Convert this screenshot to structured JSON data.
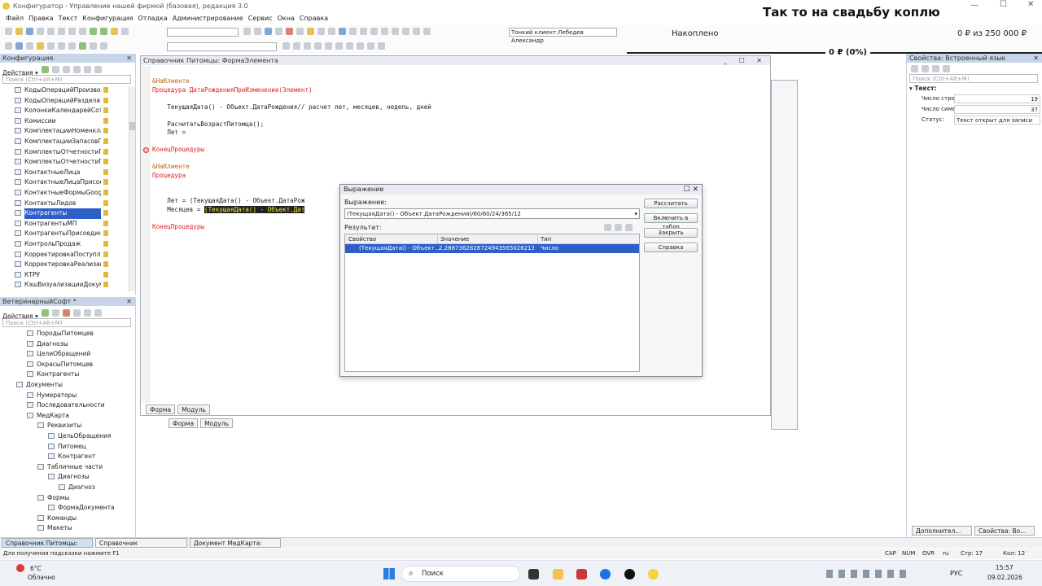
{
  "window_title": "Конфигуратор - Управление нашей фирмой (базовая), редакция 3.0",
  "menu": [
    "Файл",
    "Правка",
    "Текст",
    "Конфигурация",
    "Отладка",
    "Администрирование",
    "Сервис",
    "Окна",
    "Справка"
  ],
  "client_combo": "Тонкий клиент:Лебедев Александр",
  "overlay": {
    "title": "Так то на свадьбу коплю",
    "saved_label": "Накоплено",
    "amount": "0 ₽ из 250 000 ₽",
    "percent": "0 ₽ (0%)",
    "progress": 0
  },
  "config_panel": {
    "title": "Конфигурация",
    "actions": "Действия",
    "search": "Поиск (Ctrl+Alt+M)",
    "items": [
      "КодыОперацийПроизвол...",
      "КодыОперацийРаздела7...",
      "КолонкиКалендарейСотру...",
      "Комиссии",
      "КомплектацииНоменклат...",
      "КомплектацииЗапасовПр...",
      "КомплектыОтчетностиПо...",
      "КомплектыОтчетностиПе...",
      "КонтактныеЛица",
      "КонтактныеЛицаПриcoeд...",
      "КонтактныеФормыGoogle",
      "КонтактыЛидов",
      "Контрагенты",
      "КонтрагентыМП",
      "КонтрагентыПрисоединен...",
      "КонтрольПродаж",
      "КорректировкаПоступлен...",
      "КорректировкаРеализаци...",
      "КТРУ",
      "КэшВизуализацииДокуме..."
    ],
    "selected": 12
  },
  "vet_panel": {
    "title": "ВетеринарныйСофт *",
    "actions": "Действия",
    "search": "Поиск (Ctrl+Alt+M)",
    "items": [
      {
        "t": "ПородыПитомцев",
        "l": 1
      },
      {
        "t": "Диагнозы",
        "l": 1
      },
      {
        "t": "ЦелиОбращений",
        "l": 1
      },
      {
        "t": "ОкрасыПитомцев",
        "l": 1
      },
      {
        "t": "Контрагенты",
        "l": 1
      },
      {
        "t": "Документы",
        "l": 0
      },
      {
        "t": "Нумераторы",
        "l": 1
      },
      {
        "t": "Последовательности",
        "l": 1
      },
      {
        "t": "МедКарта",
        "l": 1
      },
      {
        "t": "Реквизиты",
        "l": 2
      },
      {
        "t": "ЦельОбращения",
        "l": 3
      },
      {
        "t": "Питомец",
        "l": 3
      },
      {
        "t": "Контрагент",
        "l": 3
      },
      {
        "t": "Табличные части",
        "l": 2
      },
      {
        "t": "Диагнозы",
        "l": 3
      },
      {
        "t": "Диагноз",
        "l": 4
      },
      {
        "t": "Формы",
        "l": 2
      },
      {
        "t": "ФормаДокумента",
        "l": 3
      },
      {
        "t": "Команды",
        "l": 2
      },
      {
        "t": "Макеты",
        "l": 2
      }
    ]
  },
  "editor": {
    "title": "Справочник Питомцы: ФормаЭлемента",
    "lines": [
      {
        "p": "&НаКлиенте",
        "c": "pre"
      },
      {
        "p": "Процедура ДатаРожденияПриИзменении(Элемент)",
        "c": "kw"
      },
      {
        "p": "",
        "c": "tx"
      },
      {
        "p": "    ТекущаяДата() - Объект.ДатаРождения// расчет лет, месяцев, недель, дней",
        "c": "tx"
      },
      {
        "p": "",
        "c": "tx"
      },
      {
        "p": "    РасчитатьВозрастПитомца();",
        "c": "tx"
      },
      {
        "p": "    Лет = ",
        "c": "tx"
      },
      {
        "p": "",
        "c": "tx"
      },
      {
        "p": "КонецПроцедуры",
        "c": "kw"
      },
      {
        "p": "",
        "c": "tx"
      },
      {
        "p": "&НаКлиенте",
        "c": "pre"
      },
      {
        "p": "Процедура",
        "c": "kw"
      },
      {
        "p": "",
        "c": "tx"
      },
      {
        "p": "",
        "c": "tx"
      },
      {
        "p": "    Лет = (ТекущаяДата() - Объект.ДатаРож",
        "c": "tx"
      },
      {
        "p": "    Месяцев = ",
        "c": "tx"
      },
      {
        "p": "",
        "c": "tx"
      },
      {
        "p": "КонецПроцедуры",
        "c": "kw"
      }
    ],
    "highlight": "(ТекущаяДата() - Объект.Дат",
    "tabs": [
      "Форма",
      "Модуль"
    ]
  },
  "dialog": {
    "title": "Выражение",
    "expr_label": "Выражение:",
    "expr": "(ТекущаяДата() - Объект.ДатаРождения)/60/60/24/365/12",
    "result_label": "Результат:",
    "cols": [
      "Свойство",
      "Значение",
      "Тип"
    ],
    "row": [
      "(ТекущаяДата() - Объект...",
      "2,28873628287249435650262134...",
      "Число"
    ],
    "buttons": [
      "Рассчитать",
      "Включить в табло",
      "Закрыть",
      "Справка"
    ]
  },
  "props": {
    "title": "Свойства: Встроенный язык",
    "search": "Поиск (Ctrl+Alt+M)",
    "section": "Текст:",
    "rows": [
      {
        "k": "Число строк:",
        "v": "19"
      },
      {
        "k": "Число символ:",
        "v": "37"
      },
      {
        "k": "Статус:",
        "v": "Текст открыт для записи"
      }
    ],
    "tabs": [
      "Дополнител...",
      "Свойства: Во..."
    ]
  },
  "open_windows": [
    "Справочник Питомцы: Фор...",
    "Справочник ОкрасыПитомц...",
    "Документ МедКарта: Форм..."
  ],
  "status": {
    "hint": "Для получения подсказки нажмите F1",
    "cap": "CAP",
    "num": "NUM",
    "ovr": "OVR",
    "lang": "ru",
    "line": "Стр: 17",
    "col": "Кол: 12"
  },
  "taskbar": {
    "temp": "6°C",
    "weather": "Облачно",
    "search": "Поиск",
    "lang": "РУС",
    "time": "15:57",
    "date": "09.02.2026"
  }
}
